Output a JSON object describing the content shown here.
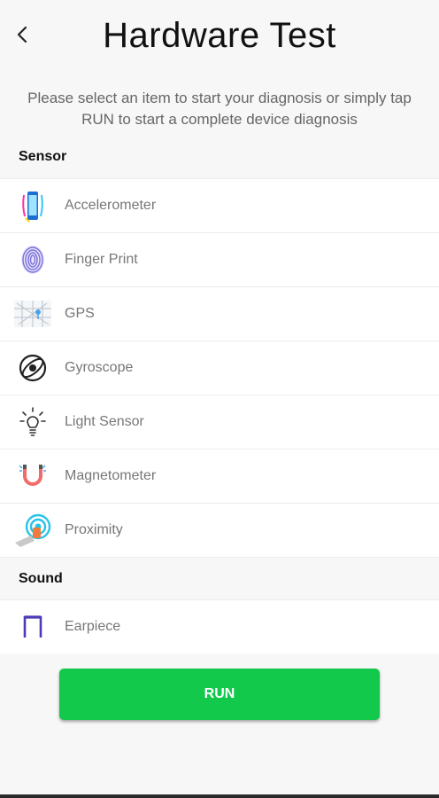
{
  "header": {
    "title": "Hardware Test",
    "back_icon": "chevron-left-icon"
  },
  "subtitle": "Please select an item to start your diagnosis or simply tap RUN to start a complete device diagnosis",
  "sections": [
    {
      "label": "Sensor",
      "items": [
        {
          "label": "Accelerometer",
          "icon": "phone-rotate-icon"
        },
        {
          "label": "Finger Print",
          "icon": "fingerprint-icon"
        },
        {
          "label": "GPS",
          "icon": "map-icon"
        },
        {
          "label": "Gyroscope",
          "icon": "gyroscope-icon"
        },
        {
          "label": "Light Sensor",
          "icon": "light-bulb-icon"
        },
        {
          "label": "Magnetometer",
          "icon": "magnet-icon"
        },
        {
          "label": "Proximity",
          "icon": "proximity-hand-icon"
        }
      ]
    },
    {
      "label": "Sound",
      "items": [
        {
          "label": "Earpiece",
          "icon": "earpiece-icon"
        }
      ]
    }
  ],
  "run_label": "RUN",
  "colors": {
    "run_button": "#12c94c",
    "background": "#f7f7f7"
  }
}
